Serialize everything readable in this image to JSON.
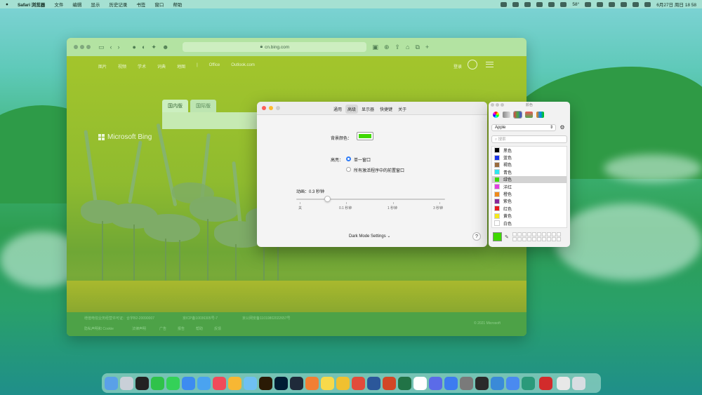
{
  "menubar": {
    "apple": "",
    "app_name": "Safari 浏览器",
    "items": [
      "文件",
      "编辑",
      "显示",
      "历史记录",
      "书签",
      "窗口",
      "帮助"
    ],
    "status": {
      "temp": "58°",
      "date_time": "6月27日 周日 18 58"
    }
  },
  "browser": {
    "url": "cn.bing.com",
    "nav_links": [
      "图片",
      "视频",
      "学术",
      "词典",
      "地图",
      "|",
      "Office",
      "Outlook.com"
    ],
    "login": "登录",
    "tabs": [
      "国内版",
      "国际版"
    ],
    "logo_text": "Microsoft Bing",
    "footer_line1": [
      "增值电信业务经营许可证：合字B2-20090007",
      "京ICP备10036305号-7",
      "京公网安备11010802022657号"
    ],
    "footer_line2": [
      "隐私声明和 Cookie",
      "法律声明",
      "广告",
      "报告",
      "帮助",
      "反馈"
    ],
    "copyright": "© 2021 Microsoft"
  },
  "prefs": {
    "tabs": [
      "通用",
      "高级",
      "显示器",
      "快捷键",
      "关于"
    ],
    "selected_tab": "高级",
    "bg_color_label": "背景颜色：",
    "highlight_label": "高亮：",
    "radio_single": "单一窗口",
    "radio_all": "所有激活程序中的前置窗口",
    "animation_label": "动画：0.3 秒钟",
    "animation_value_seconds": 0.3,
    "slider_ticks": [
      "关",
      "0.1 秒钟",
      "1 秒钟",
      "3 秒钟"
    ],
    "dark_mode": "Dark Mode Settings ⌄",
    "help": "?",
    "bg_color": "#3fd800"
  },
  "colors": {
    "title": "颜色",
    "palette": "Apple",
    "search_placeholder": "搜索",
    "list": [
      {
        "name": "黑色",
        "hex": "#000000"
      },
      {
        "name": "蓝色",
        "hex": "#1a33e8"
      },
      {
        "name": "褐色",
        "hex": "#9a6b3c"
      },
      {
        "name": "青色",
        "hex": "#2ee6f0"
      },
      {
        "name": "绿色",
        "hex": "#3fd800"
      },
      {
        "name": "洋红",
        "hex": "#e23de0"
      },
      {
        "name": "橙色",
        "hex": "#f08a1a"
      },
      {
        "name": "紫色",
        "hex": "#8a2a9a"
      },
      {
        "name": "红色",
        "hex": "#e81c1c"
      },
      {
        "name": "黄色",
        "hex": "#f5e81a"
      },
      {
        "name": "白色",
        "hex": "#ffffff"
      }
    ],
    "selected": "绿色",
    "gear": "⚙"
  },
  "dock": {
    "icons": [
      "finder-icon",
      "launchpad-icon",
      "qq-icon",
      "wechat-icon",
      "messages-icon",
      "mail-icon",
      "safari-icon",
      "music-icon",
      "photos-icon",
      "preview-icon",
      "illustrator-icon",
      "photoshop-icon",
      "pycharm-icon",
      "claquette-icon",
      "notes-icon",
      "tencent-video-icon",
      "chrome-icon",
      "word-icon",
      "powerpoint-icon",
      "excel-icon",
      "calendar-icon",
      "dict-icon",
      "baidu-netdisk-icon",
      "system-prefs-icon",
      "terminal-icon",
      "screenshot-icon",
      "feishu-icon",
      "edge-icon",
      "netease-music-icon",
      "files-icon",
      "trash-icon"
    ],
    "colors": [
      "#5aa0e8",
      "#c9d0d8",
      "#222222",
      "#2fc24a",
      "#34d158",
      "#3d8bf0",
      "#4aa3f0",
      "#f04a5a",
      "#f7b733",
      "#6fc0f2",
      "#2a1a05",
      "#001d34",
      "#1f2a3a",
      "#f27f34",
      "#f7d94a",
      "#f0c030",
      "#e24b3b",
      "#2b579a",
      "#d24726",
      "#217346",
      "#ffffff",
      "#5b6be8",
      "#3d7cf0",
      "#7a7a7a",
      "#2a2a2a",
      "#3a8ad8",
      "#4a8af0",
      "#2a9a7a",
      "#d22b2b",
      "#e8e8e8",
      "#d8dde2"
    ]
  }
}
